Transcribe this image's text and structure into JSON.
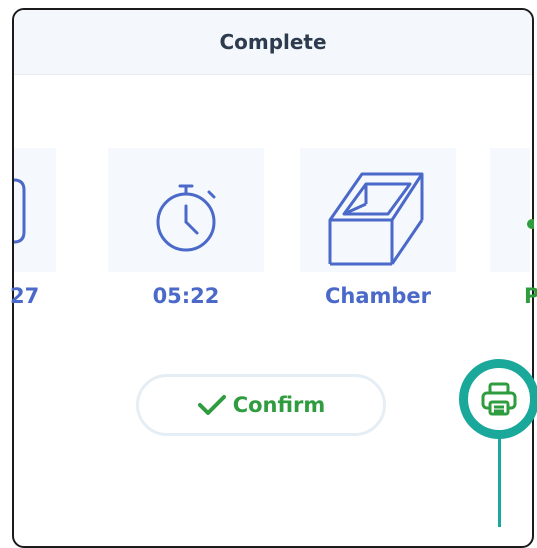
{
  "dialog": {
    "title": "Complete"
  },
  "tiles": [
    {
      "label": "27",
      "icon": "partial-icon"
    },
    {
      "label": "05:22",
      "icon": "stopwatch-icon"
    },
    {
      "label": "Chamber",
      "icon": "chamber-icon"
    },
    {
      "label": "P",
      "icon": "partial-green-icon"
    }
  ],
  "actions": {
    "confirm_label": "Confirm",
    "confirm_icon": "checkmark-icon",
    "print_icon": "printer-icon"
  },
  "colors": {
    "accent_blue": "#4a69c9",
    "success_green": "#2f9c3f",
    "highlight_teal": "#1aa89a"
  }
}
